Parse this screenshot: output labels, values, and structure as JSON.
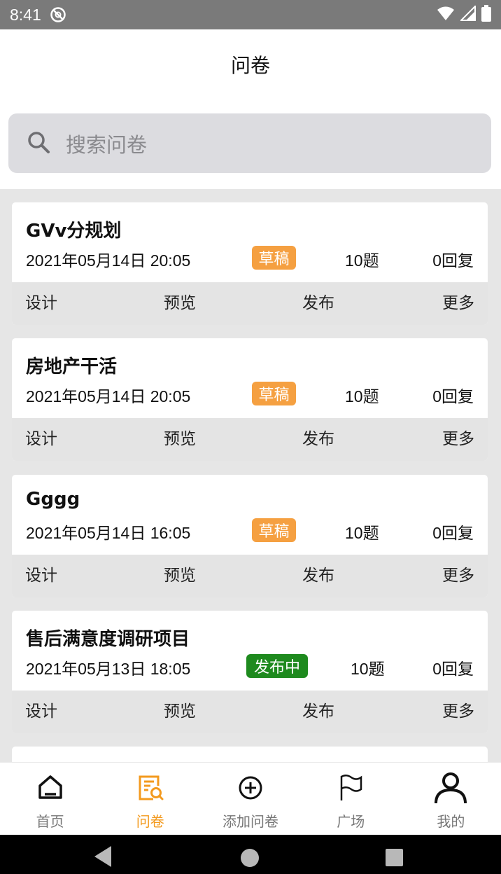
{
  "status_bar": {
    "time": "8:41"
  },
  "app_bar": {
    "title": "问卷"
  },
  "search": {
    "placeholder": "搜索问卷"
  },
  "surveys": [
    {
      "name": "GVv分规划",
      "date": "2021年05月14日 20:05",
      "status": "草稿",
      "status_type": "draft",
      "questions": "10题",
      "replies": "0回复"
    },
    {
      "name": "房地产干活",
      "date": "2021年05月14日 20:05",
      "status": "草稿",
      "status_type": "draft",
      "questions": "10题",
      "replies": "0回复"
    },
    {
      "name": "Gggg",
      "date": "2021年05月14日 16:05",
      "status": "草稿",
      "status_type": "draft",
      "questions": "10题",
      "replies": "0回复"
    },
    {
      "name": "售后满意度调研项目",
      "date": "2021年05月13日 18:05",
      "status": "发布中",
      "status_type": "published",
      "questions": "10题",
      "replies": "0回复"
    }
  ],
  "card_actions": {
    "design": "设计",
    "preview": "预览",
    "publish": "发布",
    "more": "更多"
  },
  "tabs": [
    {
      "label": "首页",
      "icon": "home-icon"
    },
    {
      "label": "问卷",
      "icon": "survey-icon",
      "active": true
    },
    {
      "label": "添加问卷",
      "icon": "add-circle-icon"
    },
    {
      "label": "广场",
      "icon": "flag-icon"
    },
    {
      "label": "我的",
      "icon": "user-icon"
    }
  ],
  "colors": {
    "accent": "#f39a1e",
    "draft": "#f5a041",
    "published": "#1e8a1e",
    "status_bar": "#7a7a7a"
  }
}
